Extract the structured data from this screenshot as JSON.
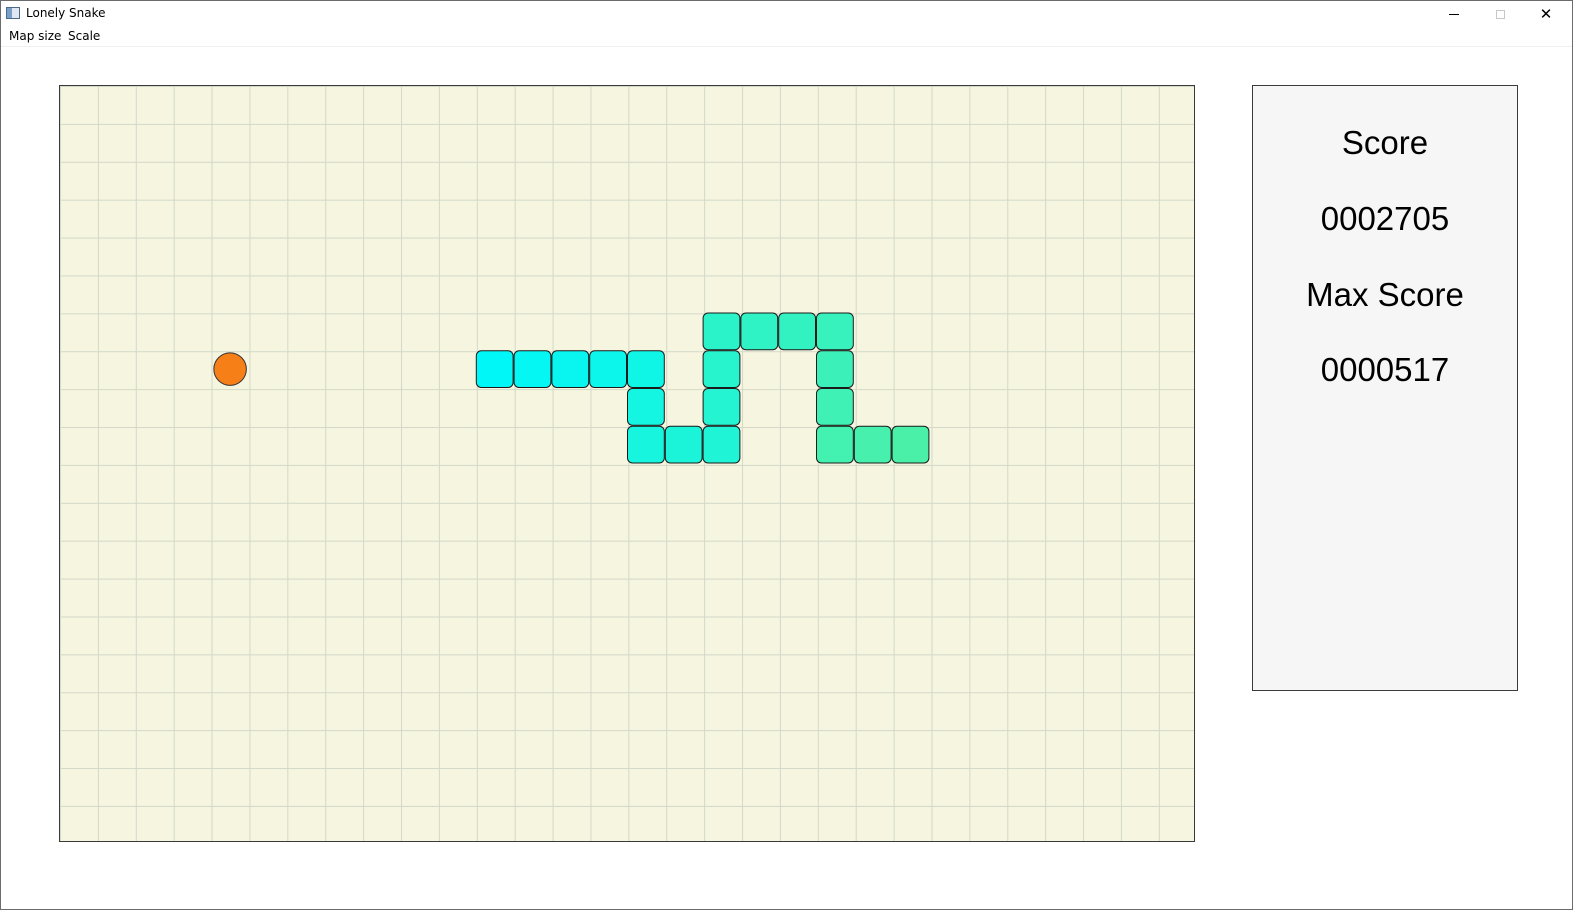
{
  "window": {
    "title": "Lonely Snake",
    "icon": "app-window-icon",
    "controls": [
      "minimize-icon",
      "maximize-icon",
      "close-icon"
    ],
    "close_glyph": "✕"
  },
  "menu": {
    "items": [
      "Map size",
      "Scale"
    ]
  },
  "board": {
    "columns": 30,
    "rows": 20,
    "background_color": "#f6f5e0",
    "grid_color": "#d3d8c8",
    "food": {
      "col": 4,
      "row": 7,
      "color": "#f77f17"
    },
    "snake": {
      "head_color": "#00f7f7",
      "tail_color": "#4bf0a8",
      "segments": [
        [
          11,
          7
        ],
        [
          12,
          7
        ],
        [
          13,
          7
        ],
        [
          14,
          7
        ],
        [
          15,
          7
        ],
        [
          15,
          8
        ],
        [
          15,
          9
        ],
        [
          16,
          9
        ],
        [
          17,
          9
        ],
        [
          17,
          8
        ],
        [
          17,
          7
        ],
        [
          17,
          6
        ],
        [
          18,
          6
        ],
        [
          19,
          6
        ],
        [
          20,
          6
        ],
        [
          20,
          7
        ],
        [
          20,
          8
        ],
        [
          20,
          9
        ],
        [
          21,
          9
        ],
        [
          22,
          9
        ]
      ]
    }
  },
  "scoreboard": {
    "score_label": "Score",
    "score_value": "0002705",
    "max_score_label": "Max Score",
    "max_score_value": "0000517"
  }
}
